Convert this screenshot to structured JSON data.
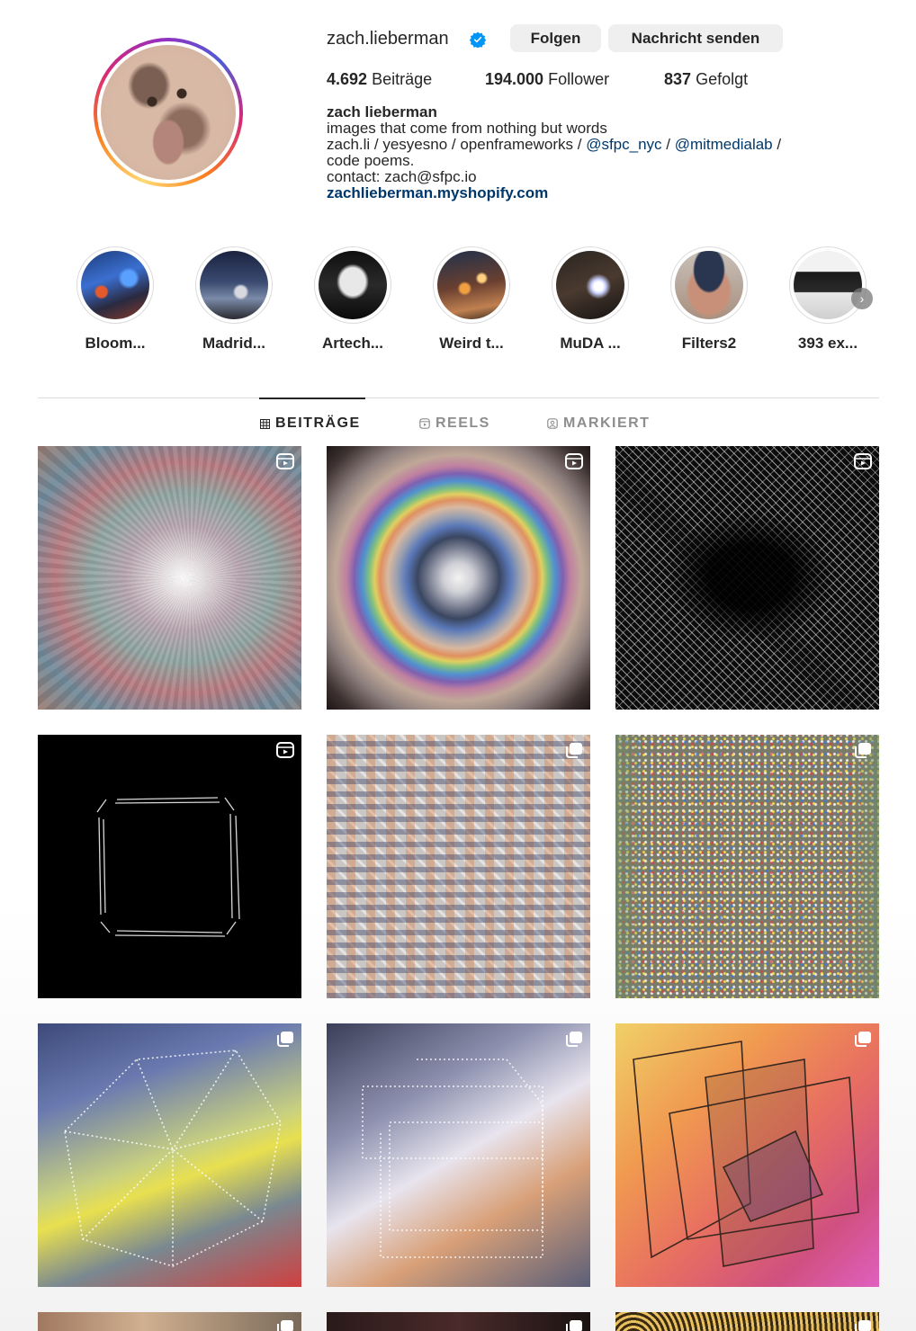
{
  "profile": {
    "username": "zach.lieberman",
    "follow_label": "Folgen",
    "message_label": "Nachricht senden",
    "stats": {
      "posts_count": "4.692",
      "posts_label": "Beiträge",
      "followers_count": "194.000",
      "followers_label": "Follower",
      "following_count": "837",
      "following_label": "Gefolgt"
    },
    "bio": {
      "name": "zach lieberman",
      "line1": "images that come from nothing but words",
      "line2_prefix": "zach.li / yesyesno / openframeworks / ",
      "mention1": "@sfpc_nyc",
      "line2_sep": " / ",
      "mention2": "@mitmedialab",
      "line2_suffix": " /",
      "line3": "code poems.",
      "line4": "contact: zach@sfpc.io",
      "link": "zachlieberman.myshopify.com"
    }
  },
  "highlights": [
    {
      "label": "Bloom..."
    },
    {
      "label": "Madrid..."
    },
    {
      "label": "Artech..."
    },
    {
      "label": "Weird t..."
    },
    {
      "label": "MuDA ..."
    },
    {
      "label": "Filters2"
    },
    {
      "label": "393 ex..."
    }
  ],
  "tabs": {
    "posts": "BEITRÄGE",
    "reels": "REELS",
    "tagged": "MARKIERT"
  },
  "colors": {
    "text": "#262626",
    "muted": "#8e8e8e",
    "link": "#00376b",
    "verified": "#0095f6",
    "button_bg": "#efefef"
  },
  "icons": {
    "verified": "verified-badge-icon",
    "reel_badge": "reel-icon",
    "carousel_badge": "carousel-icon",
    "next": "chevron-right-icon"
  }
}
